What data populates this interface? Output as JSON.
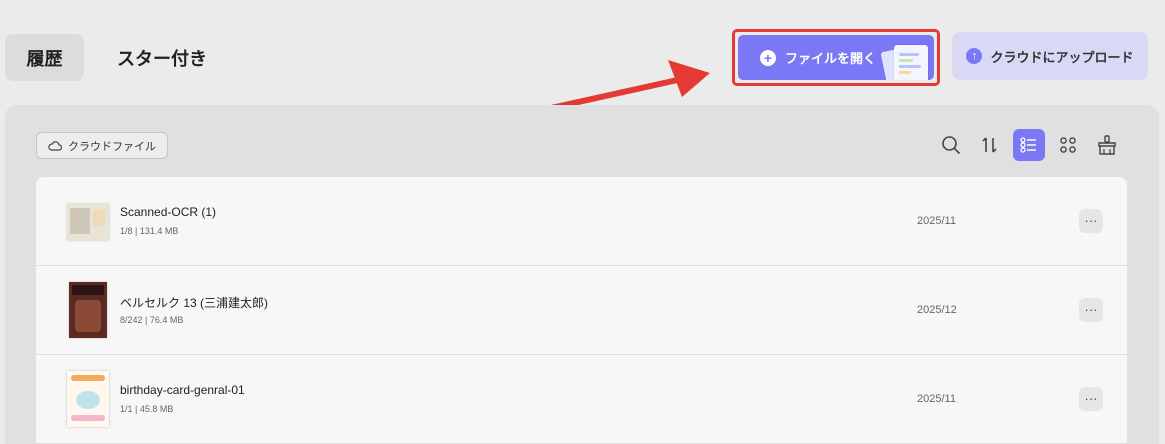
{
  "tabs": {
    "history": "履歴",
    "starred": "スター付き"
  },
  "actions": {
    "open_file": "ファイルを開く",
    "upload_cloud": "クラウドにアップロード"
  },
  "panel": {
    "cloud_chip": "クラウドファイル",
    "toolbar_icons": [
      "search-icon",
      "sort-icon",
      "list-view-icon",
      "grid-view-icon",
      "clear-icon"
    ]
  },
  "files": [
    {
      "name": "Scanned-OCR (1)",
      "meta": "1/8 | 131.4 MB",
      "date": "2025/11"
    },
    {
      "name": "ベルセルク 13 (三浦建太郎)",
      "meta": "8/242 | 76.4 MB",
      "date": "2025/12"
    },
    {
      "name": "birthday-card-genral-01",
      "meta": "1/1 | 45.8 MB",
      "date": "2025/11"
    }
  ],
  "more_glyph": "···",
  "colors": {
    "accent": "#7b78f5",
    "accent_light": "#d9d9f5",
    "highlight": "#e53935"
  }
}
